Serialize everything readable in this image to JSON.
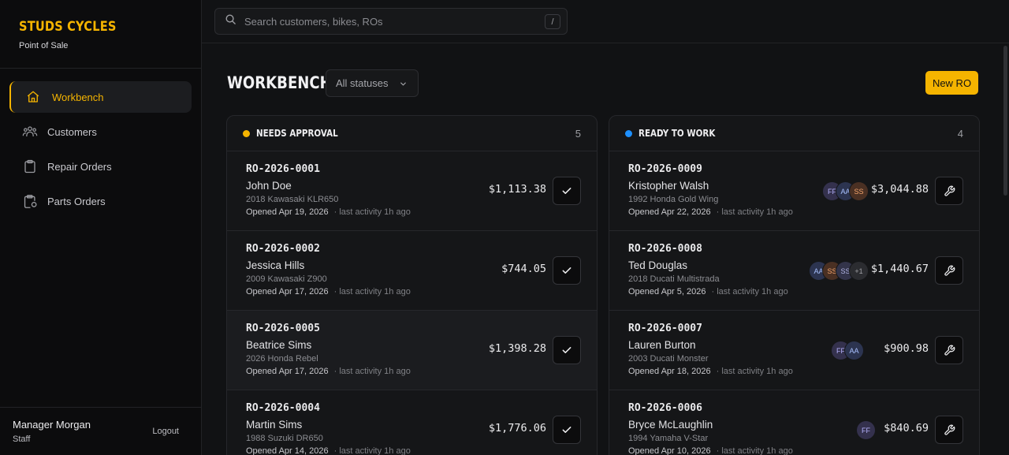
{
  "brand": {
    "title": "STUDS CYCLES",
    "subtitle": "Point of Sale"
  },
  "nav": [
    {
      "label": "Workbench",
      "icon": "home-icon",
      "active": true
    },
    {
      "label": "Customers",
      "icon": "users-icon"
    },
    {
      "label": "Repair Orders",
      "icon": "clipboard-icon"
    },
    {
      "label": "Parts Orders",
      "icon": "parts-clipboard-icon"
    }
  ],
  "user": {
    "name": "Manager Morgan",
    "role": "Staff",
    "logout": "Logout"
  },
  "search": {
    "placeholder": "Search customers, bikes, ROs",
    "shortcut": "/"
  },
  "page": {
    "title": "WORKBENCH",
    "filter": "All statuses",
    "new_button": "New RO"
  },
  "colors": {
    "accent": "#f5b400",
    "approval": "#f5b400",
    "ready": "#1e90ff"
  },
  "columns": [
    {
      "title": "NEEDS APPROVAL",
      "count": "5",
      "cards": [
        {
          "ro": "RO-2026-0001",
          "customer": "John Doe",
          "bike": "2018 Kawasaki KLR650",
          "opened": "Opened Apr 19, 2026",
          "activity": "· last activity 1h ago",
          "amount": "$1,113.38"
        },
        {
          "ro": "RO-2026-0002",
          "customer": "Jessica Hills",
          "bike": "2009 Kawasaki Z900",
          "opened": "Opened Apr 17, 2026",
          "activity": "· last activity 1h ago",
          "amount": "$744.05"
        },
        {
          "ro": "RO-2026-0005",
          "customer": "Beatrice Sims",
          "bike": "2026 Honda Rebel",
          "opened": "Opened Apr 17, 2026",
          "activity": "· last activity 1h ago",
          "amount": "$1,398.28"
        },
        {
          "ro": "RO-2026-0004",
          "customer": "Martin Sims",
          "bike": "1988 Suzuki DR650",
          "opened": "Opened Apr 14, 2026",
          "activity": "· last activity 1h ago",
          "amount": "$1,776.06"
        }
      ]
    },
    {
      "title": "READY TO WORK",
      "count": "4",
      "cards": [
        {
          "ro": "RO-2026-0009",
          "customer": "Kristopher Walsh",
          "bike": "1992 Honda Gold Wing",
          "opened": "Opened Apr 22, 2026",
          "activity": "· last activity 1h ago",
          "amount": "$3,044.88",
          "techs": [
            "FF",
            "AA",
            "SS"
          ]
        },
        {
          "ro": "RO-2026-0008",
          "customer": "Ted Douglas",
          "bike": "2018 Ducati Multistrada",
          "opened": "Opened Apr 5, 2026",
          "activity": "· last activity 1h ago",
          "amount": "$1,440.67",
          "techs": [
            "AA",
            "SS",
            "SS",
            "+1"
          ]
        },
        {
          "ro": "RO-2026-0007",
          "customer": "Lauren Burton",
          "bike": "2003 Ducati Monster",
          "opened": "Opened Apr 18, 2026",
          "activity": "· last activity 1h ago",
          "amount": "$900.98",
          "techs": [
            "FF",
            "AA"
          ]
        },
        {
          "ro": "RO-2026-0006",
          "customer": "Bryce McLaughlin",
          "bike": "1994 Yamaha V-Star",
          "opened": "Opened Apr 10, 2026",
          "activity": "· last activity 1h ago",
          "amount": "$840.69",
          "techs": [
            "FF"
          ]
        }
      ]
    }
  ]
}
